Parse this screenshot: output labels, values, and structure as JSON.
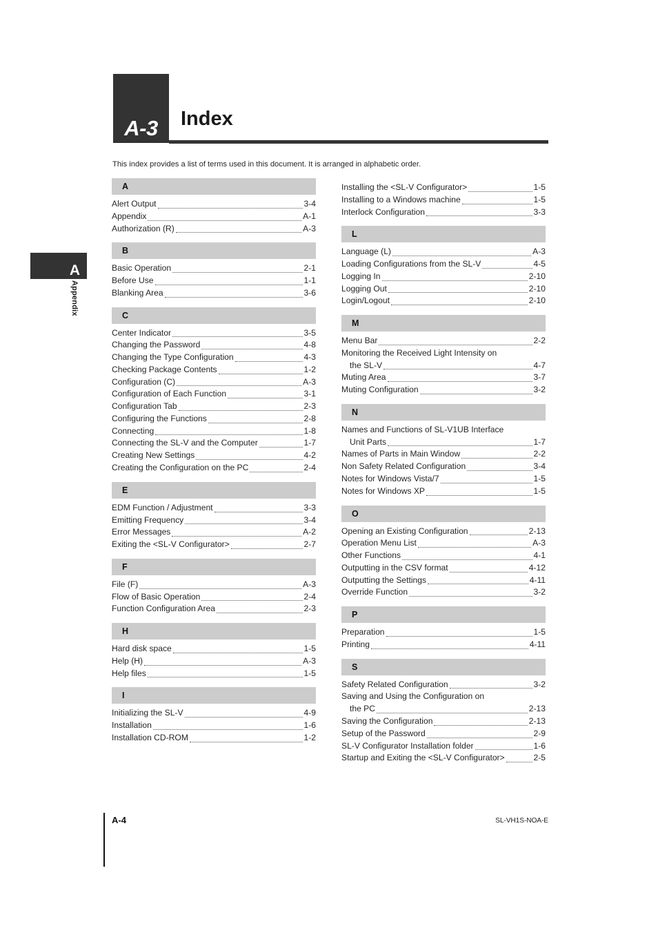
{
  "sidebar": {
    "tab_letter": "A",
    "vertical_label": "Appendix"
  },
  "header": {
    "chapter_badge": "A-3",
    "title": "Index"
  },
  "intro": {
    "text": "This index provides a list of terms used in this document. It is arranged in alphabetic order."
  },
  "footer": {
    "page_number": "A-4",
    "doc_code": "SL-VH1S-NOA-E"
  },
  "columns": {
    "left": [
      {
        "letter": "A",
        "entries": [
          {
            "label": "Alert Output",
            "page": "3-4"
          },
          {
            "label": "Appendix",
            "page": "A-1"
          },
          {
            "label": "Authorization (R)",
            "page": "A-3"
          }
        ]
      },
      {
        "letter": "B",
        "entries": [
          {
            "label": "Basic Operation",
            "page": "2-1"
          },
          {
            "label": "Before Use",
            "page": "1-1"
          },
          {
            "label": "Blanking Area",
            "page": "3-6"
          }
        ]
      },
      {
        "letter": "C",
        "entries": [
          {
            "label": "Center Indicator",
            "page": "3-5"
          },
          {
            "label": "Changing the Password",
            "page": "4-8"
          },
          {
            "label": "Changing the Type Configuration",
            "page": "4-3"
          },
          {
            "label": "Checking Package Contents",
            "page": "1-2"
          },
          {
            "label": "Configuration (C)",
            "page": "A-3"
          },
          {
            "label": "Configuration of Each Function",
            "page": "3-1"
          },
          {
            "label": "Configuration Tab",
            "page": "2-3"
          },
          {
            "label": "Configuring the Functions",
            "page": "2-8"
          },
          {
            "label": "Connecting",
            "page": "1-8"
          },
          {
            "label": "Connecting the SL-V and the Computer",
            "page": "1-7"
          },
          {
            "label": "Creating New Settings",
            "page": "4-2"
          },
          {
            "label": "Creating the Configuration on the PC",
            "page": "2-4"
          }
        ]
      },
      {
        "letter": "E",
        "entries": [
          {
            "label": "EDM Function / Adjustment",
            "page": "3-3"
          },
          {
            "label": "Emitting Frequency",
            "page": "3-4"
          },
          {
            "label": "Error Messages",
            "page": "A-2"
          },
          {
            "label": "Exiting the <SL-V Configurator>",
            "page": "2-7"
          }
        ]
      },
      {
        "letter": "F",
        "entries": [
          {
            "label": "File (F)",
            "page": "A-3"
          },
          {
            "label": "Flow of Basic Operation",
            "page": "2-4"
          },
          {
            "label": "Function Configuration Area",
            "page": "2-3"
          }
        ]
      },
      {
        "letter": "H",
        "entries": [
          {
            "label": "Hard disk space",
            "page": "1-5"
          },
          {
            "label": "Help (H)",
            "page": "A-3"
          },
          {
            "label": "Help files",
            "page": "1-5"
          }
        ]
      },
      {
        "letter": "I",
        "entries": [
          {
            "label": "Initializing the SL-V",
            "page": "4-9"
          },
          {
            "label": "Installation",
            "page": "1-6"
          },
          {
            "label": "Installation CD-ROM",
            "page": "1-2"
          }
        ]
      }
    ],
    "right": [
      {
        "letter": "",
        "entries": [
          {
            "label": "Installing the <SL-V Configurator>",
            "page": "1-5"
          },
          {
            "label": "Installing to a Windows machine",
            "page": "1-5"
          },
          {
            "label": "Interlock Configuration",
            "page": "3-3"
          }
        ]
      },
      {
        "letter": "L",
        "entries": [
          {
            "label": "Language (L)",
            "page": "A-3"
          },
          {
            "label": "Loading Configurations from the SL-V",
            "page": "4-5"
          },
          {
            "label": "Logging In",
            "page": "2-10"
          },
          {
            "label": "Logging Out",
            "page": "2-10"
          },
          {
            "label": "Login/Logout",
            "page": "2-10"
          }
        ]
      },
      {
        "letter": "M",
        "entries": [
          {
            "label": "Menu Bar",
            "page": "2-2"
          },
          {
            "label": "Monitoring the Received Light Intensity on",
            "page": "",
            "wrap_first": true
          },
          {
            "label": "the SL-V",
            "page": "4-7",
            "continued": true
          },
          {
            "label": "Muting Area",
            "page": "3-7"
          },
          {
            "label": "Muting Configuration",
            "page": "3-2"
          }
        ]
      },
      {
        "letter": "N",
        "entries": [
          {
            "label": "Names and Functions of SL-V1UB Interface",
            "page": "",
            "wrap_first": true
          },
          {
            "label": "Unit Parts",
            "page": "1-7",
            "continued": true
          },
          {
            "label": "Names of Parts in Main Window",
            "page": "2-2"
          },
          {
            "label": "Non Safety Related Configuration",
            "page": "3-4"
          },
          {
            "label": "Notes for Windows Vista/7",
            "page": "1-5"
          },
          {
            "label": "Notes for Windows XP",
            "page": "1-5"
          }
        ]
      },
      {
        "letter": "O",
        "entries": [
          {
            "label": "Opening an Existing Configuration",
            "page": "2-13"
          },
          {
            "label": "Operation Menu List",
            "page": "A-3"
          },
          {
            "label": "Other Functions",
            "page": "4-1"
          },
          {
            "label": "Outputting in the CSV format",
            "page": "4-12"
          },
          {
            "label": "Outputting the Settings",
            "page": "4-11"
          },
          {
            "label": "Override Function",
            "page": "3-2"
          }
        ]
      },
      {
        "letter": "P",
        "entries": [
          {
            "label": "Preparation",
            "page": "1-5"
          },
          {
            "label": "Printing",
            "page": "4-11"
          }
        ]
      },
      {
        "letter": "S",
        "entries": [
          {
            "label": "Safety Related Configuration",
            "page": "3-2"
          },
          {
            "label": "Saving and Using the Configuration on",
            "page": "",
            "wrap_first": true
          },
          {
            "label": "the PC",
            "page": "2-13",
            "continued": true
          },
          {
            "label": "Saving the Configuration",
            "page": "2-13"
          },
          {
            "label": "Setup of the Password",
            "page": "2-9"
          },
          {
            "label": "SL-V Configurator Installation folder",
            "page": "1-6"
          },
          {
            "label": "Startup and Exiting the <SL-V Configurator>",
            "page": "2-5"
          }
        ]
      }
    ]
  }
}
